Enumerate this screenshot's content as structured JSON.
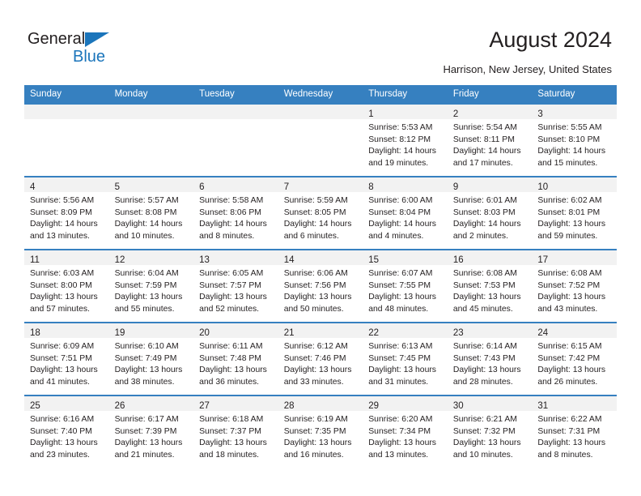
{
  "brand": {
    "line1": "General",
    "line2": "Blue",
    "accent_color": "#1b75bb",
    "triangle_icon": "logo-triangle-icon"
  },
  "header": {
    "title": "August 2024",
    "subtitle": "Harrison, New Jersey, United States"
  },
  "colors": {
    "header_row_bg": "#3680c0",
    "daynum_band_bg": "#f2f2f2",
    "text": "#231f20",
    "brand_blue": "#1b75bb"
  },
  "weekday_headers": [
    "Sunday",
    "Monday",
    "Tuesday",
    "Wednesday",
    "Thursday",
    "Friday",
    "Saturday"
  ],
  "weeks": [
    [
      {
        "day": "",
        "lines": []
      },
      {
        "day": "",
        "lines": []
      },
      {
        "day": "",
        "lines": []
      },
      {
        "day": "",
        "lines": []
      },
      {
        "day": "1",
        "lines": [
          "Sunrise: 5:53 AM",
          "Sunset: 8:12 PM",
          "Daylight: 14 hours",
          "and 19 minutes."
        ]
      },
      {
        "day": "2",
        "lines": [
          "Sunrise: 5:54 AM",
          "Sunset: 8:11 PM",
          "Daylight: 14 hours",
          "and 17 minutes."
        ]
      },
      {
        "day": "3",
        "lines": [
          "Sunrise: 5:55 AM",
          "Sunset: 8:10 PM",
          "Daylight: 14 hours",
          "and 15 minutes."
        ]
      }
    ],
    [
      {
        "day": "4",
        "lines": [
          "Sunrise: 5:56 AM",
          "Sunset: 8:09 PM",
          "Daylight: 14 hours",
          "and 13 minutes."
        ]
      },
      {
        "day": "5",
        "lines": [
          "Sunrise: 5:57 AM",
          "Sunset: 8:08 PM",
          "Daylight: 14 hours",
          "and 10 minutes."
        ]
      },
      {
        "day": "6",
        "lines": [
          "Sunrise: 5:58 AM",
          "Sunset: 8:06 PM",
          "Daylight: 14 hours",
          "and 8 minutes."
        ]
      },
      {
        "day": "7",
        "lines": [
          "Sunrise: 5:59 AM",
          "Sunset: 8:05 PM",
          "Daylight: 14 hours",
          "and 6 minutes."
        ]
      },
      {
        "day": "8",
        "lines": [
          "Sunrise: 6:00 AM",
          "Sunset: 8:04 PM",
          "Daylight: 14 hours",
          "and 4 minutes."
        ]
      },
      {
        "day": "9",
        "lines": [
          "Sunrise: 6:01 AM",
          "Sunset: 8:03 PM",
          "Daylight: 14 hours",
          "and 2 minutes."
        ]
      },
      {
        "day": "10",
        "lines": [
          "Sunrise: 6:02 AM",
          "Sunset: 8:01 PM",
          "Daylight: 13 hours",
          "and 59 minutes."
        ]
      }
    ],
    [
      {
        "day": "11",
        "lines": [
          "Sunrise: 6:03 AM",
          "Sunset: 8:00 PM",
          "Daylight: 13 hours",
          "and 57 minutes."
        ]
      },
      {
        "day": "12",
        "lines": [
          "Sunrise: 6:04 AM",
          "Sunset: 7:59 PM",
          "Daylight: 13 hours",
          "and 55 minutes."
        ]
      },
      {
        "day": "13",
        "lines": [
          "Sunrise: 6:05 AM",
          "Sunset: 7:57 PM",
          "Daylight: 13 hours",
          "and 52 minutes."
        ]
      },
      {
        "day": "14",
        "lines": [
          "Sunrise: 6:06 AM",
          "Sunset: 7:56 PM",
          "Daylight: 13 hours",
          "and 50 minutes."
        ]
      },
      {
        "day": "15",
        "lines": [
          "Sunrise: 6:07 AM",
          "Sunset: 7:55 PM",
          "Daylight: 13 hours",
          "and 48 minutes."
        ]
      },
      {
        "day": "16",
        "lines": [
          "Sunrise: 6:08 AM",
          "Sunset: 7:53 PM",
          "Daylight: 13 hours",
          "and 45 minutes."
        ]
      },
      {
        "day": "17",
        "lines": [
          "Sunrise: 6:08 AM",
          "Sunset: 7:52 PM",
          "Daylight: 13 hours",
          "and 43 minutes."
        ]
      }
    ],
    [
      {
        "day": "18",
        "lines": [
          "Sunrise: 6:09 AM",
          "Sunset: 7:51 PM",
          "Daylight: 13 hours",
          "and 41 minutes."
        ]
      },
      {
        "day": "19",
        "lines": [
          "Sunrise: 6:10 AM",
          "Sunset: 7:49 PM",
          "Daylight: 13 hours",
          "and 38 minutes."
        ]
      },
      {
        "day": "20",
        "lines": [
          "Sunrise: 6:11 AM",
          "Sunset: 7:48 PM",
          "Daylight: 13 hours",
          "and 36 minutes."
        ]
      },
      {
        "day": "21",
        "lines": [
          "Sunrise: 6:12 AM",
          "Sunset: 7:46 PM",
          "Daylight: 13 hours",
          "and 33 minutes."
        ]
      },
      {
        "day": "22",
        "lines": [
          "Sunrise: 6:13 AM",
          "Sunset: 7:45 PM",
          "Daylight: 13 hours",
          "and 31 minutes."
        ]
      },
      {
        "day": "23",
        "lines": [
          "Sunrise: 6:14 AM",
          "Sunset: 7:43 PM",
          "Daylight: 13 hours",
          "and 28 minutes."
        ]
      },
      {
        "day": "24",
        "lines": [
          "Sunrise: 6:15 AM",
          "Sunset: 7:42 PM",
          "Daylight: 13 hours",
          "and 26 minutes."
        ]
      }
    ],
    [
      {
        "day": "25",
        "lines": [
          "Sunrise: 6:16 AM",
          "Sunset: 7:40 PM",
          "Daylight: 13 hours",
          "and 23 minutes."
        ]
      },
      {
        "day": "26",
        "lines": [
          "Sunrise: 6:17 AM",
          "Sunset: 7:39 PM",
          "Daylight: 13 hours",
          "and 21 minutes."
        ]
      },
      {
        "day": "27",
        "lines": [
          "Sunrise: 6:18 AM",
          "Sunset: 7:37 PM",
          "Daylight: 13 hours",
          "and 18 minutes."
        ]
      },
      {
        "day": "28",
        "lines": [
          "Sunrise: 6:19 AM",
          "Sunset: 7:35 PM",
          "Daylight: 13 hours",
          "and 16 minutes."
        ]
      },
      {
        "day": "29",
        "lines": [
          "Sunrise: 6:20 AM",
          "Sunset: 7:34 PM",
          "Daylight: 13 hours",
          "and 13 minutes."
        ]
      },
      {
        "day": "30",
        "lines": [
          "Sunrise: 6:21 AM",
          "Sunset: 7:32 PM",
          "Daylight: 13 hours",
          "and 10 minutes."
        ]
      },
      {
        "day": "31",
        "lines": [
          "Sunrise: 6:22 AM",
          "Sunset: 7:31 PM",
          "Daylight: 13 hours",
          "and 8 minutes."
        ]
      }
    ]
  ]
}
